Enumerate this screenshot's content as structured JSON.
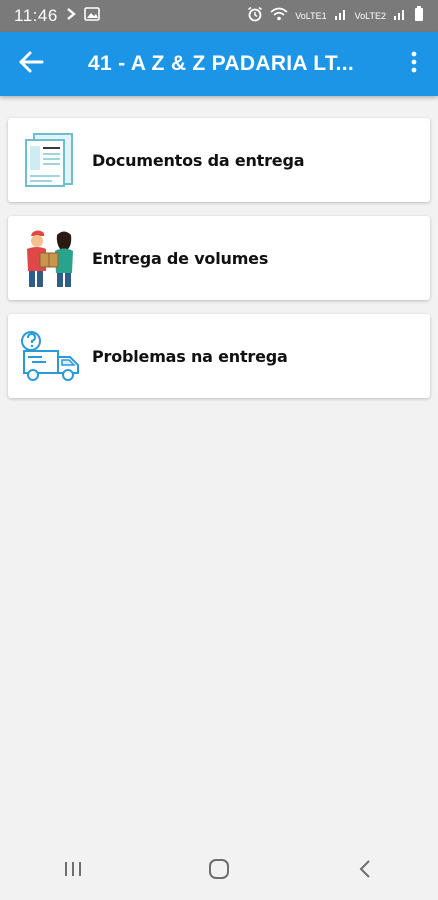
{
  "status_bar": {
    "time": "11:46",
    "network_label_1": "VoLTE1",
    "network_label_2": "VoLTE2"
  },
  "app_bar": {
    "title": "41 - A Z & Z PADARIA LT...",
    "color": "#1c95e7"
  },
  "menu_items": [
    {
      "label": "Documentos da entrega",
      "icon": "documents-icon"
    },
    {
      "label": "Entrega de volumes",
      "icon": "delivery-people-icon"
    },
    {
      "label": "Problemas na entrega",
      "icon": "truck-question-icon"
    }
  ]
}
